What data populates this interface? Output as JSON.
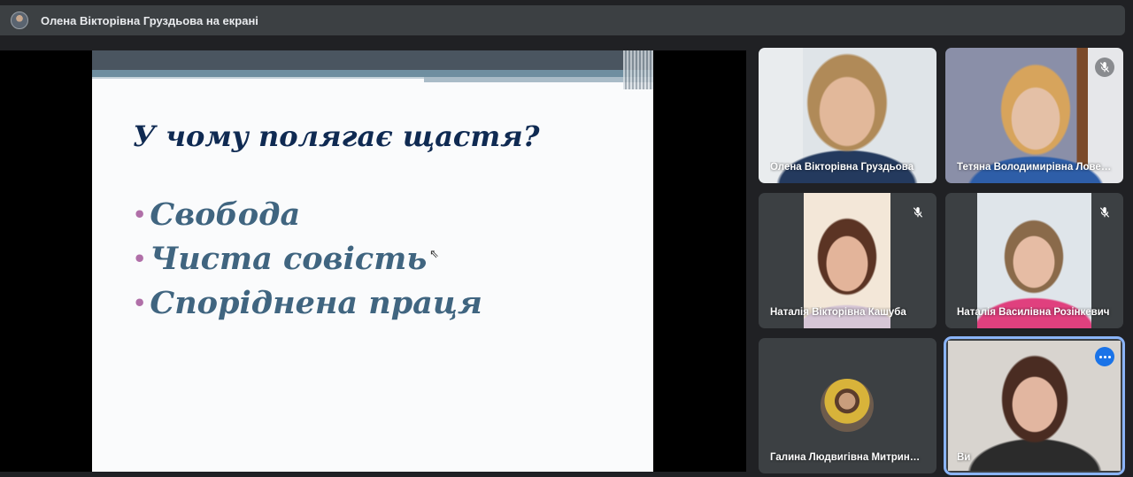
{
  "top_bar": {
    "presenter_text": "Олена Вікторівна Груздьова на екрані"
  },
  "slide": {
    "title": "У чому полягає щастя?",
    "items": [
      "Свобода",
      "Чиста совість",
      "Споріднена праця"
    ]
  },
  "participants": [
    {
      "name": "Олена Вікторівна Груздьова",
      "muted": false
    },
    {
      "name": "Тетяна Володимирівна Лове…",
      "muted": true
    },
    {
      "name": "Наталія Вікторівна Кашуба",
      "muted": true
    },
    {
      "name": "Наталія Василівна Розінкевич",
      "muted": true
    },
    {
      "name": "Галина Людвигівна Митрин…",
      "muted": false
    },
    {
      "name": "Ви",
      "muted": false,
      "active": true
    }
  ],
  "colors": {
    "accent": "#8ab4f8",
    "tile_bg": "#3c4043",
    "slide_title": "#0f2a52",
    "slide_text": "#406580",
    "bullet": "#b06fa8"
  }
}
